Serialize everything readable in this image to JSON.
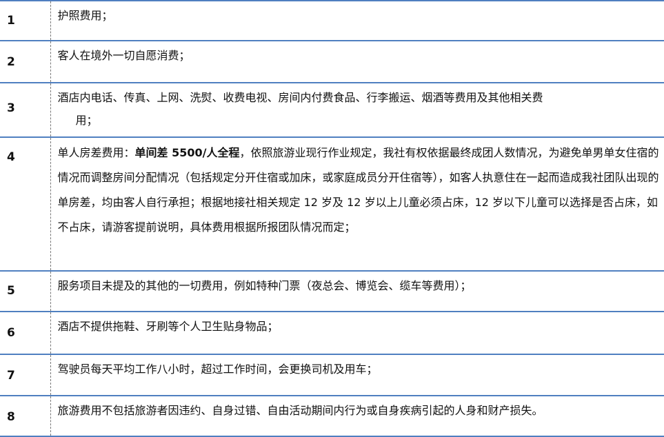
{
  "rows": [
    {
      "num": "1",
      "text": "护照费用；"
    },
    {
      "num": "2",
      "text": "客人在境外一切自愿消费；"
    },
    {
      "num": "3",
      "text": "酒店内电话、传真、上网、洗熨、收费电视、房间内付费食品、行李搬运、烟酒等费用及其他相关费",
      "cont": "用；"
    },
    {
      "num": "4",
      "pre": "单人房差费用：",
      "bold": "单间差 5500/人全程",
      "post": "，依照旅游业现行作业规定，我社有权依据最终成团人数情况，为避免单男单女住宿的情况而调整房间分配情况（包括规定分开住宿或加床，或家庭成员分开住宿等），如客人执意住在一起而造成我社团队出现的单房差，均由客人自行承担；根据地接社相关规定 12 岁及 12 岁以上儿童必须占床，12 岁以下儿童可以选择是否占床，如不占床，请游客提前说明，具体费用根据所报团队情况而定；"
    },
    {
      "num": "5",
      "text": "服务项目未提及的其他的一切费用，例如特种门票（夜总会、博览会、缆车等费用）；"
    },
    {
      "num": "6",
      "text": "酒店不提供拖鞋、牙刷等个人卫生贴身物品；"
    },
    {
      "num": "7",
      "text": "驾驶员每天平均工作八小时，超过工作时间，会更换司机及用车；"
    },
    {
      "num": "8",
      "text": "旅游费用不包括旅游者因违约、自身过错、自由活动期间内行为或自身疾病引起的人身和财产损失。"
    }
  ]
}
